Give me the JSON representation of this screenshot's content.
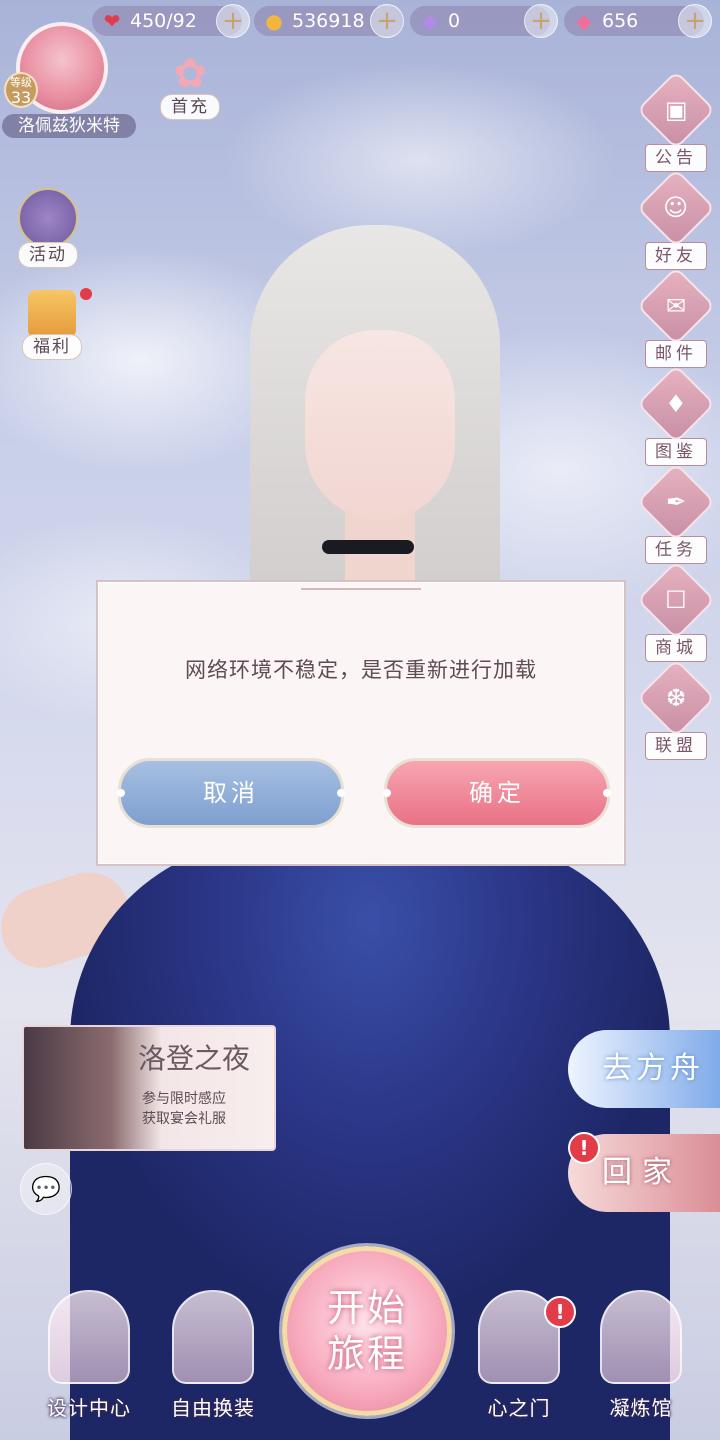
{
  "topbar": {
    "stamina": {
      "icon": "heart-icon",
      "value": "450/92"
    },
    "gold": {
      "icon": "cat-coin-icon",
      "value": "536918"
    },
    "diamond": {
      "icon": "purple-diamond-icon",
      "value": "0"
    },
    "pink_diamond": {
      "icon": "pink-diamond-icon",
      "value": "656"
    }
  },
  "profile": {
    "level_label": "等级",
    "level": "33",
    "name": "洛佩兹狄米特"
  },
  "left_menu": {
    "first_recharge": "首充",
    "activity": "活动",
    "welfare": "福利"
  },
  "right_menu": [
    "公告",
    "好友",
    "邮件",
    "图鉴",
    "任务",
    "商城",
    "联盟"
  ],
  "banner": {
    "title": "洛登之夜",
    "line1": "参与限时感应",
    "line2": "获取宴会礼服"
  },
  "side_buttons": {
    "ark": "去方舟",
    "home": "回家",
    "alert": "!"
  },
  "bottom_nav": {
    "design": "设计中心",
    "dressup": "自由换装",
    "start_line1": "开始",
    "start_line2": "旅程",
    "heart_gate": "心之门",
    "refinery": "凝炼馆"
  },
  "dialog": {
    "message": "网络环境不稳定，是否重新进行加载",
    "cancel": "取消",
    "confirm": "确定"
  },
  "colors": {
    "accent_pink": "#e97186",
    "accent_blue": "#7e9fcf",
    "alert_red": "#e33b47"
  }
}
